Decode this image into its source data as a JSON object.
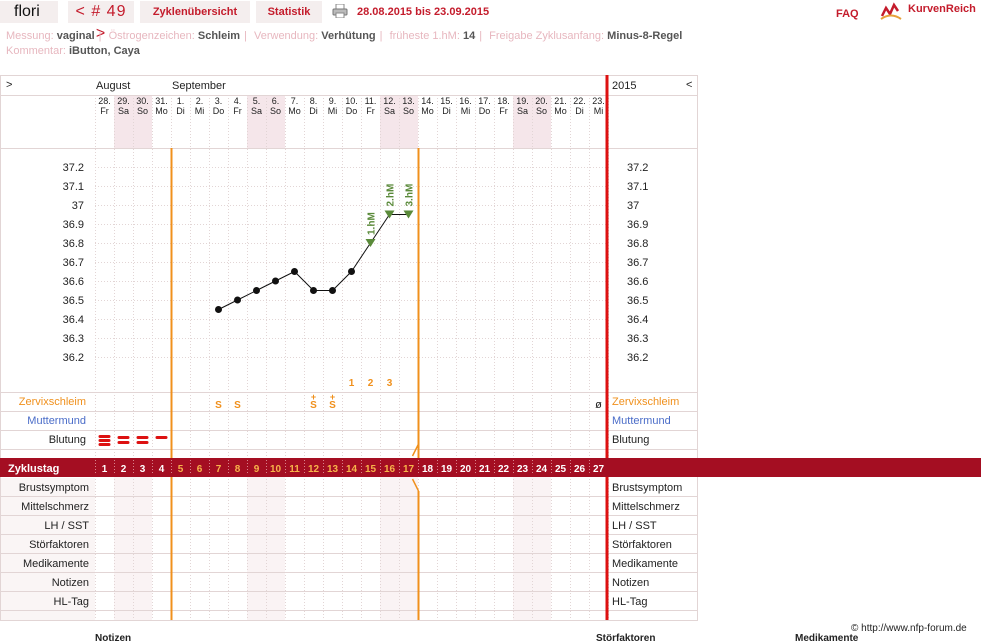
{
  "header": {
    "user": "flori",
    "cycle_nav": "< # 49 >",
    "tabs": [
      "Zyklenübersicht",
      "Statistik"
    ],
    "date_range": "28.08.2015 bis 23.09.2015",
    "faq": "FAQ",
    "brand": "KurvenReich"
  },
  "meta": {
    "line1": [
      {
        "label": "Messung:",
        "value": "vaginal"
      },
      {
        "label": "Östrogenzeichen:",
        "value": "Schleim"
      },
      {
        "label": "Verwendung:",
        "value": "Verhütung"
      },
      {
        "label": "früheste 1.hM:",
        "value": "14"
      },
      {
        "label": "Freigabe Zyklusanfang:",
        "value": "Minus-8-Regel"
      }
    ],
    "line2": [
      {
        "label": "Kommentar:",
        "value": "iButton, Caya"
      }
    ]
  },
  "chart_header": {
    "left_arrow": ">",
    "right_arrow": "<",
    "months": [
      "August",
      "September"
    ],
    "year": "2015"
  },
  "days": [
    {
      "date": "28.",
      "wd": "Fr",
      "weekend": false,
      "cycle": 1
    },
    {
      "date": "29.",
      "wd": "Sa",
      "weekend": true,
      "cycle": 2
    },
    {
      "date": "30.",
      "wd": "So",
      "weekend": true,
      "cycle": 3
    },
    {
      "date": "31.",
      "wd": "Mo",
      "weekend": false,
      "cycle": 4
    },
    {
      "date": "1.",
      "wd": "Di",
      "weekend": false,
      "cycle": 5
    },
    {
      "date": "2.",
      "wd": "Mi",
      "weekend": false,
      "cycle": 6
    },
    {
      "date": "3.",
      "wd": "Do",
      "weekend": false,
      "cycle": 7
    },
    {
      "date": "4.",
      "wd": "Fr",
      "weekend": false,
      "cycle": 8
    },
    {
      "date": "5.",
      "wd": "Sa",
      "weekend": true,
      "cycle": 9
    },
    {
      "date": "6.",
      "wd": "So",
      "weekend": true,
      "cycle": 10
    },
    {
      "date": "7.",
      "wd": "Mo",
      "weekend": false,
      "cycle": 11
    },
    {
      "date": "8.",
      "wd": "Di",
      "weekend": false,
      "cycle": 12
    },
    {
      "date": "9.",
      "wd": "Mi",
      "weekend": false,
      "cycle": 13
    },
    {
      "date": "10.",
      "wd": "Do",
      "weekend": false,
      "cycle": 14
    },
    {
      "date": "11.",
      "wd": "Fr",
      "weekend": false,
      "cycle": 15
    },
    {
      "date": "12.",
      "wd": "Sa",
      "weekend": true,
      "cycle": 16
    },
    {
      "date": "13.",
      "wd": "So",
      "weekend": true,
      "cycle": 17
    },
    {
      "date": "14.",
      "wd": "Mo",
      "weekend": false,
      "cycle": 18
    },
    {
      "date": "15.",
      "wd": "Di",
      "weekend": false,
      "cycle": 19
    },
    {
      "date": "16.",
      "wd": "Mi",
      "weekend": false,
      "cycle": 20
    },
    {
      "date": "17.",
      "wd": "Do",
      "weekend": false,
      "cycle": 21
    },
    {
      "date": "18.",
      "wd": "Fr",
      "weekend": false,
      "cycle": 22
    },
    {
      "date": "19.",
      "wd": "Sa",
      "weekend": true,
      "cycle": 23
    },
    {
      "date": "20.",
      "wd": "So",
      "weekend": true,
      "cycle": 24
    },
    {
      "date": "21.",
      "wd": "Mo",
      "weekend": false,
      "cycle": 25
    },
    {
      "date": "22.",
      "wd": "Di",
      "weekend": false,
      "cycle": 26
    },
    {
      "date": "23.",
      "wd": "Mi",
      "weekend": false,
      "cycle": 27
    }
  ],
  "chart_data": {
    "type": "line",
    "y_ticks": [
      "37.2",
      "37.1",
      "37",
      "36.9",
      "36.8",
      "36.7",
      "36.6",
      "36.5",
      "36.4",
      "36.3",
      "36.2"
    ],
    "ylim": [
      36.15,
      37.25
    ],
    "temperatures": [
      {
        "cycle_day": 7,
        "temp": 36.45
      },
      {
        "cycle_day": 8,
        "temp": 36.5
      },
      {
        "cycle_day": 9,
        "temp": 36.55
      },
      {
        "cycle_day": 10,
        "temp": 36.6
      },
      {
        "cycle_day": 11,
        "temp": 36.65
      },
      {
        "cycle_day": 12,
        "temp": 36.55
      },
      {
        "cycle_day": 13,
        "temp": 36.55
      },
      {
        "cycle_day": 14,
        "temp": 36.65
      },
      {
        "cycle_day": 15,
        "temp": 36.8
      },
      {
        "cycle_day": 16,
        "temp": 36.95
      },
      {
        "cycle_day": 17,
        "temp": 36.95
      }
    ],
    "high_labels": [
      {
        "cycle_day": 15,
        "text": "1.hM"
      },
      {
        "cycle_day": 16,
        "text": "2.hM"
      },
      {
        "cycle_day": 17,
        "text": "3.hM"
      }
    ],
    "count_labels": [
      {
        "cycle_day": 14,
        "text": "1"
      },
      {
        "cycle_day": 15,
        "text": "2"
      },
      {
        "cycle_day": 16,
        "text": "3"
      }
    ],
    "infertile_start_day": 5,
    "infertile_end_day": 17
  },
  "rows": {
    "zervix_label": "Zervixschleim",
    "zervix": [
      {
        "cycle_day": 7,
        "text": "S"
      },
      {
        "cycle_day": 8,
        "text": "S"
      },
      {
        "cycle_day": 12,
        "text": "S+"
      },
      {
        "cycle_day": 13,
        "text": "S+"
      },
      {
        "cycle_day": 27,
        "text": "ø"
      }
    ],
    "muttermund_label": "Muttermund",
    "blutung_label": "Blutung",
    "blutung": [
      {
        "cycle_day": 1,
        "level": "stark"
      },
      {
        "cycle_day": 2,
        "level": "mittel"
      },
      {
        "cycle_day": 3,
        "level": "mittel"
      },
      {
        "cycle_day": 4,
        "level": "schwach"
      }
    ],
    "zyklustag_label": "Zyklustag",
    "lower_labels": [
      "Brustsymptom",
      "Mittelschmerz",
      "LH / SST",
      "Störfaktoren",
      "Medikamente",
      "Notizen",
      "HL-Tag"
    ]
  },
  "colors": {
    "accent": "#c41c2c",
    "band": "#a40e22",
    "orange": "#f0901c",
    "weekend": "#f5e6ea",
    "grid": "#e2d5d5",
    "hm_green": "#5a8a3a",
    "muttermund": "#4a6cc8"
  },
  "footer": {
    "copyright": "© http://www.nfp-forum.de",
    "headings": [
      "Notizen",
      "Störfaktoren",
      "Medikamente"
    ]
  }
}
